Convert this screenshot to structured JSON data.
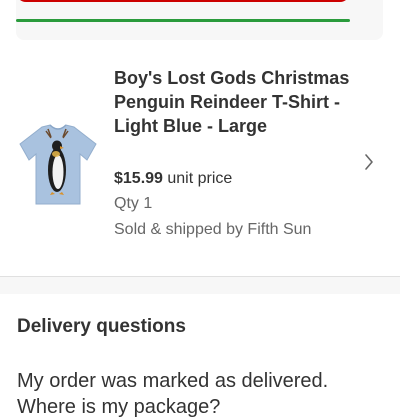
{
  "order_status": {
    "progress_percent": 100,
    "accent": "#cc0000",
    "progress_color": "#2a9b3c"
  },
  "product": {
    "title": "Boy's Lost Gods Christmas Penguin Reindeer  T-Shirt - Light Blue - Large",
    "price": "$15.99",
    "price_suffix": " unit price",
    "qty": "Qty 1",
    "seller": "Sold & shipped by Fifth Sun",
    "image": "light-blue-penguin-tshirt",
    "chevron_icon": "chevron-right-icon"
  },
  "help": {
    "title": "Delivery questions",
    "items": [
      "My order was marked as delivered. Where is my package?"
    ]
  }
}
